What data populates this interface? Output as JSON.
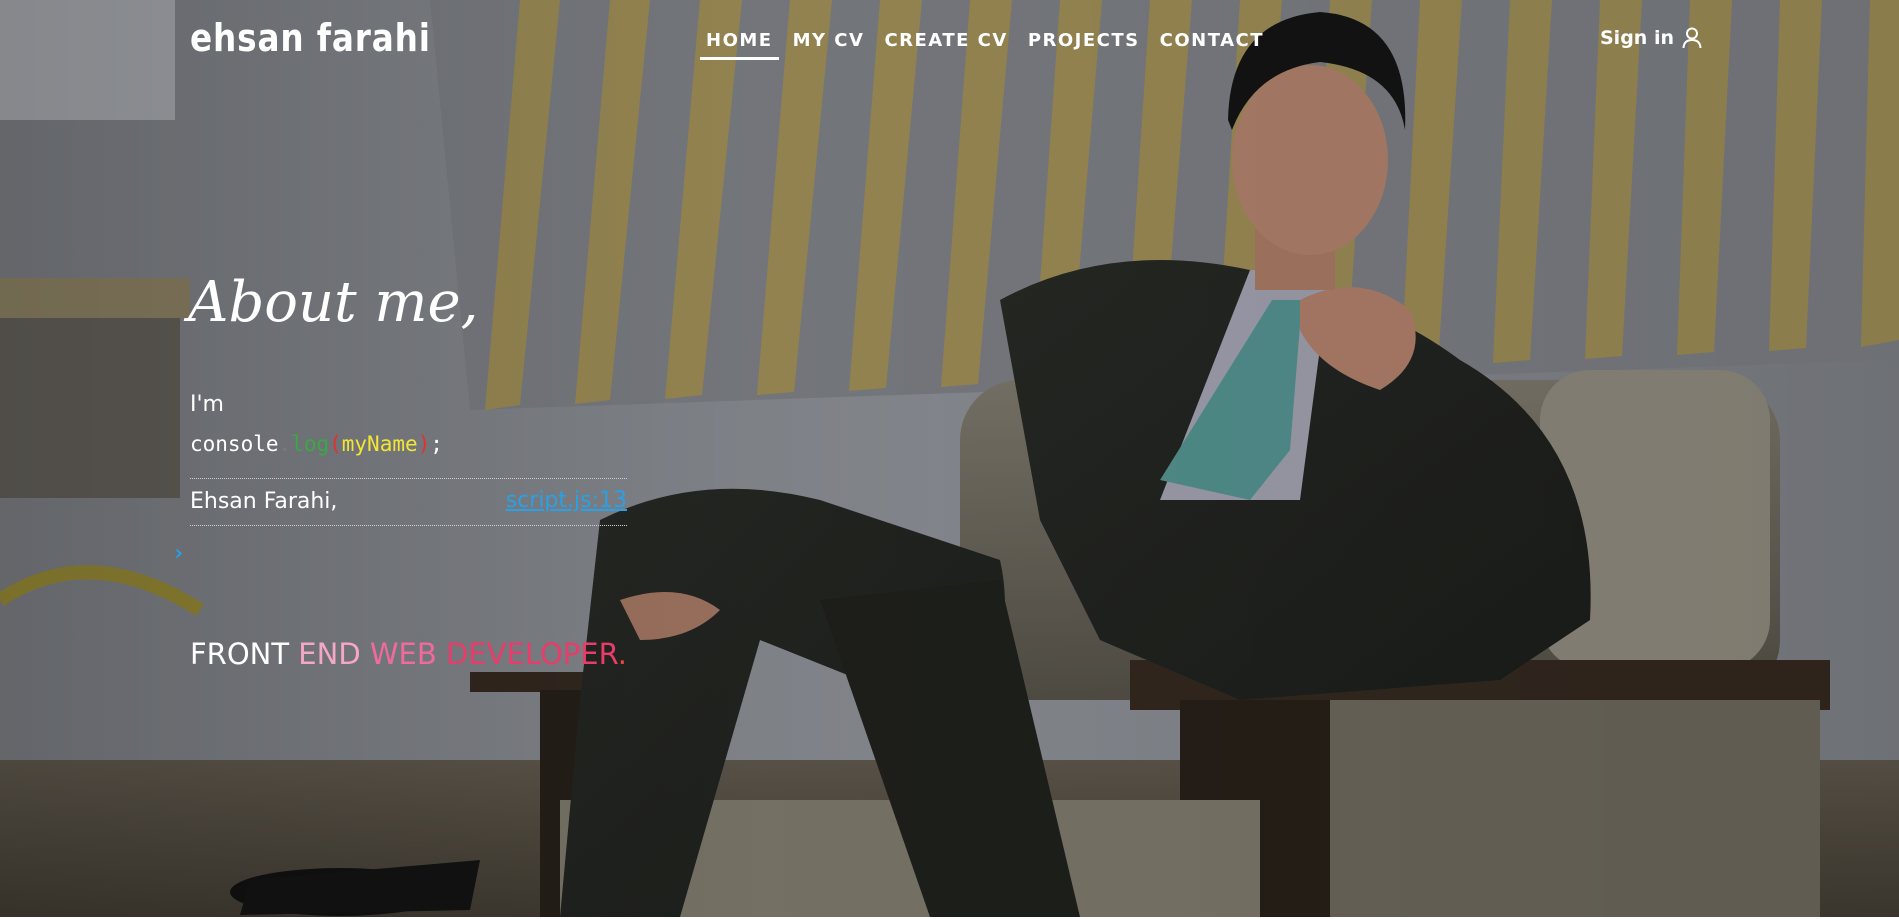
{
  "header": {
    "brand": "ehsan farahi",
    "nav": [
      {
        "label": "HOME",
        "active": true
      },
      {
        "label": "MY CV",
        "active": false
      },
      {
        "label": "CREATE CV",
        "active": false
      },
      {
        "label": "PROJECTS",
        "active": false
      },
      {
        "label": "CONTACT",
        "active": false
      }
    ],
    "signin": {
      "label": "Sign in",
      "icon": "user-icon"
    }
  },
  "about": {
    "title": "About me,",
    "intro": "I'm",
    "code": {
      "object": "console",
      "dot": ".",
      "method": "log",
      "open_paren": "(",
      "argument": "myName",
      "close_paren": ")",
      "semicolon": ";"
    },
    "console_output": {
      "value": "Ehsan Farahi,",
      "source": "script.js:13"
    },
    "prompt": "›",
    "role": {
      "word1": "FRONT ",
      "word2": "END ",
      "word3": "WEB ",
      "word4": "DEVELOPER",
      "dot": "."
    }
  },
  "colors": {
    "code_method": "#3aa845",
    "code_paren": "#e0322f",
    "code_argument": "#f2e535",
    "link": "#2aa0e6",
    "role_pink_light": "#f4a8c4",
    "role_pink": "#ef6b9a",
    "role_pink_dark": "#e83c6a"
  }
}
